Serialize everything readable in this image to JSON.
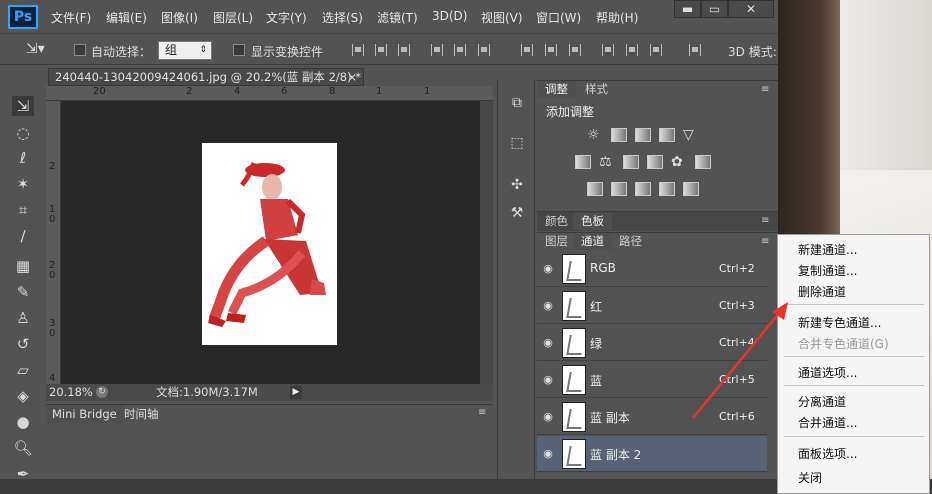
{
  "app": {
    "logo": "Ps"
  },
  "menubar": [
    "文件(F)",
    "编辑(E)",
    "图像(I)",
    "图层(L)",
    "文字(Y)",
    "选择(S)",
    "滤镜(T)",
    "3D(D)",
    "视图(V)",
    "窗口(W)",
    "帮助(H)"
  ],
  "window_controls": {
    "minimize": "▬",
    "maximize": "▭",
    "close": "✕"
  },
  "options": {
    "auto_select_label": "自动选择：",
    "auto_select_value": "组",
    "show_transform_label": "显示变换控件",
    "mode_3d_label": "3D 模式:"
  },
  "document": {
    "tab_title": "240440-13042009424061.jpg @ 20.2%(蓝 副本 2/8) *",
    "tab_close": "×",
    "ruler_top": [
      "20",
      "2",
      "4",
      "6",
      "8",
      "1",
      "1"
    ],
    "ruler_left": [
      "2",
      "1\n0",
      "2\n0",
      "3\n0",
      "4"
    ],
    "zoom": "20.18%",
    "doc_size": "文档:1.90M/3.17M"
  },
  "bottom_tabs": [
    "Mini Bridge",
    "时间轴"
  ],
  "adjustments": {
    "tabs": [
      "调整",
      "样式"
    ],
    "heading": "添加调整"
  },
  "swatch_tabs": [
    "颜色",
    "色板"
  ],
  "channels_tabs": [
    "图层",
    "通道",
    "路径"
  ],
  "channels": [
    {
      "name": "RGB",
      "shortcut": "Ctrl+2"
    },
    {
      "name": "红",
      "shortcut": "Ctrl+3"
    },
    {
      "name": "绿",
      "shortcut": "Ctrl+4"
    },
    {
      "name": "蓝",
      "shortcut": "Ctrl+5"
    },
    {
      "name": "蓝 副本",
      "shortcut": "Ctrl+6"
    },
    {
      "name": "蓝 副本 2",
      "shortcut": ""
    }
  ],
  "context_menu": [
    {
      "label": "新建通道...",
      "enabled": true
    },
    {
      "label": "复制通道...",
      "enabled": true
    },
    {
      "label": "删除通道",
      "enabled": true
    },
    {
      "label": "新建专色通道...",
      "enabled": true
    },
    {
      "label": "合并专色通道(G)",
      "enabled": false
    },
    {
      "label": "通道选项...",
      "enabled": true
    },
    {
      "label": "分离通道",
      "enabled": true
    },
    {
      "label": "合并通道...",
      "enabled": true
    },
    {
      "label": "面板选项...",
      "enabled": true
    },
    {
      "label": "关闭",
      "enabled": true
    }
  ],
  "colors": {
    "arrow": "#e8332a",
    "selected_row": "#586276",
    "accent": "#2fa3ff"
  }
}
